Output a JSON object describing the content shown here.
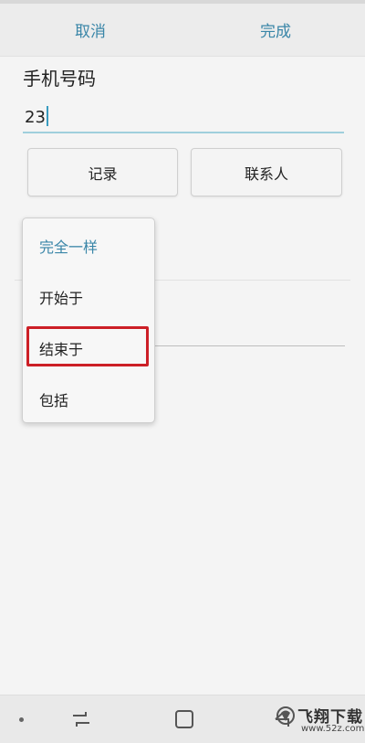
{
  "toolbar": {
    "cancel_label": "取消",
    "done_label": "完成"
  },
  "form": {
    "phone_label": "手机号码",
    "phone_value": "23"
  },
  "actions": {
    "records_label": "记录",
    "contacts_label": "联系人"
  },
  "dropdown": {
    "options": [
      {
        "label": "完全一样",
        "selected": true
      },
      {
        "label": "开始于",
        "selected": false
      },
      {
        "label": "结束于",
        "selected": false,
        "highlighted": true
      },
      {
        "label": "包括",
        "selected": false
      }
    ]
  },
  "colors": {
    "accent": "#3a86a8",
    "input_underline": "#9fcfdc",
    "highlight": "#cc1f26"
  },
  "navbar": {
    "icons": [
      "dot-icon",
      "recent-apps-icon",
      "home-icon",
      "back-icon"
    ]
  },
  "watermark": {
    "title": "飞翔下载",
    "url": "www.52z.com"
  }
}
